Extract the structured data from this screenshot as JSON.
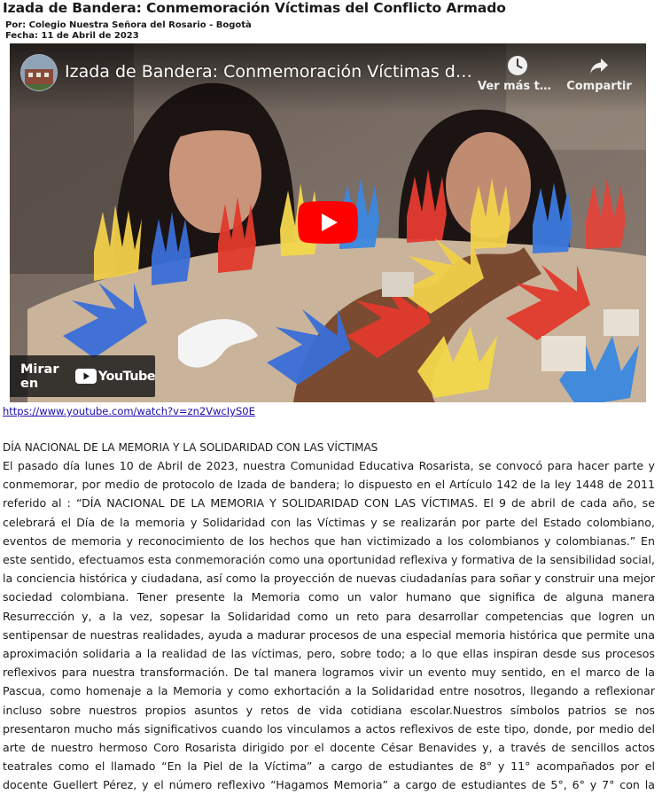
{
  "article": {
    "title": "Izada de Bandera: Conmemoración Víctimas del Conflicto Armado",
    "author": "Por: Colegio Nuestra Señora del Rosario - Bogotà",
    "date": "Fecha: 11 de Abril de 2023"
  },
  "video": {
    "title": "Izada de Bandera: Conmemoración Víctimas del Conflicto Armado",
    "watch_later_label": "Ver más tarde",
    "share_label": "Compartir",
    "watch_on_label": "Mirar en",
    "youtube_label": "YouTube",
    "icons": [
      "clock-icon",
      "share-icon",
      "play-icon",
      "youtube-logo-icon"
    ],
    "colors": {
      "play_red": "#ff0000",
      "overlay": "#171717"
    }
  },
  "link": {
    "text": "https://www.youtube.com/watch?v=zn2VwcIyS0E"
  },
  "section": {
    "heading": "DÍA NACIONAL DE LA MEMORIA Y LA SOLIDARIDAD CON LAS VÍCTIMAS"
  },
  "body": {
    "paragraph": "El pasado día lunes 10 de Abril de 2023, nuestra Comunidad Educativa Rosarista, se convocó para hacer parte y conmemorar, por medio de protocolo de Izada de bandera; lo dispuesto en el Artículo 142 de la ley 1448 de 2011 referido al : “DÍA NACIONAL DE LA MEMORIA Y SOLIDARIDAD CON LAS VÍCTIMAS. El 9 de abril de cada año, se celebrará el Día de la memoria y Solidaridad con las Víctimas y se realizarán por parte del Estado colombiano, eventos de memoria y reconocimiento de los hechos que han victimizado a los colombianos y colombianas.” En este sentido, efectuamos esta conmemoración como una oportunidad reflexiva y formativa de la sensibilidad social, la conciencia histórica y ciudadana, así como la proyección de nuevas ciudadanías para soñar y construir una mejor sociedad colombiana. Tener presente la Memoria como un valor humano que significa de alguna manera Resurrección y, a la vez, sopesar la Solidaridad como un reto para desarrollar competencias que logren un sentipensar de nuestras realidades, ayuda a madurar procesos de una especial memoria histórica que permite una aproximación solidaria a la realidad de las víctimas, pero, sobre todo; a lo que ellas inspiran desde sus procesos reflexivos para nuestra transformación. De tal manera logramos vivir un evento muy sentido, en el marco de la Pascua, como homenaje a la Memoria y como exhortación a la Solidaridad entre nosotros, llegando a reflexionar incluso sobre nuestros propios asuntos y retos de vida cotidiana escolar.Nuestros símbolos patrios se nos presentaron mucho más significativos cuando los vinculamos a actos reflexivos de este tipo, donde, por medio del arte de nuestro hermoso Coro Rosarista dirigido por el docente César Benavides y, a través de sencillos actos teatrales como el llamado “En la Piel de la Víctima” a cargo de estudiantes de 8° y 11° acompañados por el docente Guellert Pérez, y el número reflexivo “Hagamos Memoria” a cargo de estudiantes de 5°, 6° y 7° con la orientación de los docentes Kevin Ruge y María Alejandra Urquijo; nos encontramos juntos como comunidad educativa, para repensarnos en la anhelada Paz, recordando la Paz del Resucitado tal y como nos lo recordó nuestra rectora Sor Ana Cecilia Torres Herrera, O.P en sus palabras de cierre del evento.De esta manera, con expresiones"
  }
}
